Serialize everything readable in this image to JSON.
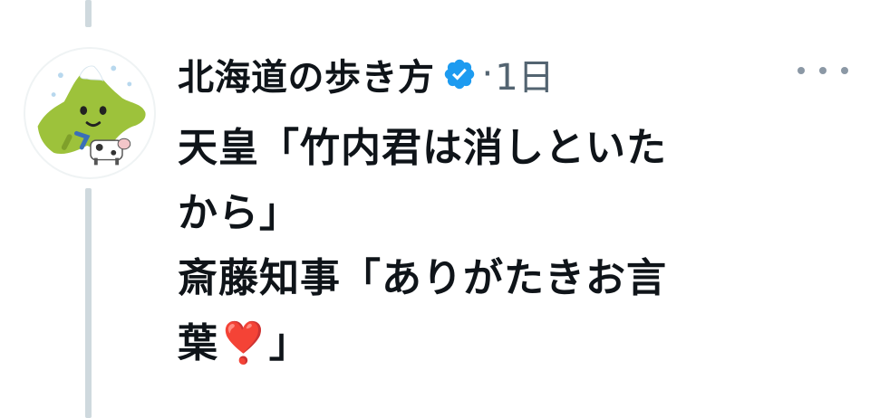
{
  "post": {
    "display_name": "北海道の歩き方",
    "verified": true,
    "separator": "·",
    "timestamp": "1日",
    "more_icon": "more-horizontal-icon",
    "body_lines": [
      "天皇「竹内君は消しといた",
      "から」",
      "斎藤知事「ありがたきお言",
      "葉",
      "」"
    ],
    "emoji": "❣️"
  },
  "colors": {
    "text": "#0f1419",
    "secondary": "#536471",
    "verified_blue": "#1d9bf0",
    "thread_line": "#cfd9de",
    "avatar_green": "#9dc23b"
  }
}
